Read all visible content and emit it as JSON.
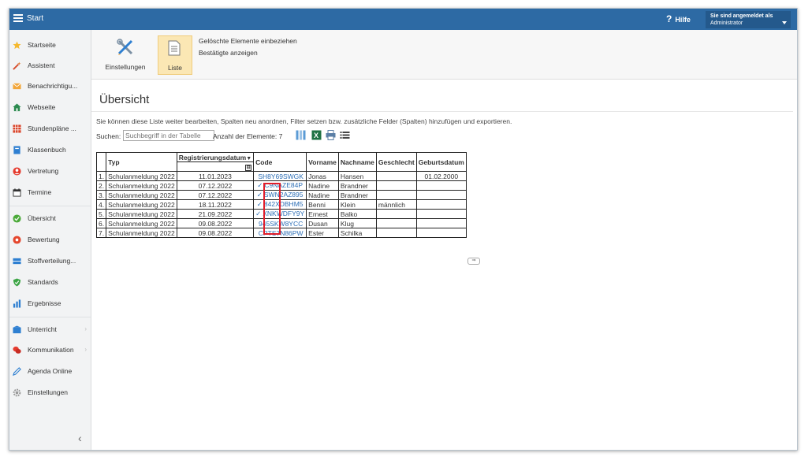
{
  "app": {
    "title": "Start",
    "help_label": "Hilfe",
    "user_line1": "Sie sind angemeldet als",
    "user_line2": "Administrator"
  },
  "sidebar": {
    "items": [
      {
        "label": "Startseite",
        "icon": "star-icon"
      },
      {
        "label": "Assistent",
        "icon": "magic-wand-icon"
      },
      {
        "label": "Benachrichtigu...",
        "icon": "envelope-icon"
      },
      {
        "label": "Webseite",
        "icon": "house-icon"
      },
      {
        "label": "Stundenpläne ...",
        "icon": "timetable-icon"
      },
      {
        "label": "Klassenbuch",
        "icon": "book-icon"
      },
      {
        "label": "Vertretung",
        "icon": "person-icon"
      },
      {
        "label": "Termine",
        "icon": "calendar-icon"
      },
      {
        "label": "Übersicht",
        "icon": "check-circle-icon"
      },
      {
        "label": "Bewertung",
        "icon": "rating-icon"
      },
      {
        "label": "Stoffverteilung...",
        "icon": "distribution-icon"
      },
      {
        "label": "Standards",
        "icon": "shield-icon"
      },
      {
        "label": "Ergebnisse",
        "icon": "bar-chart-icon"
      },
      {
        "label": "Unterricht",
        "icon": "classroom-icon"
      },
      {
        "label": "Kommunikation",
        "icon": "chat-icon"
      },
      {
        "label": "Agenda Online",
        "icon": "pen-icon"
      },
      {
        "label": "Einstellungen",
        "icon": "gear-icon"
      }
    ],
    "arrow": "›",
    "collapse": "‹"
  },
  "ribbon": {
    "settings_label": "Einstellungen",
    "list_label": "Liste",
    "link1": "Gelöschte Elemente einbeziehen",
    "link2": "Bestätigte anzeigen"
  },
  "main": {
    "title": "Übersicht",
    "description": "Sie können diese Liste weiter bearbeiten, Spalten neu anordnen, Filter setzen bzw. zusätzliche Felder (Spalten) hinzufügen und exportieren.",
    "search_label": "Suchen:",
    "search_placeholder": "Suchbegriff in der Tabelle",
    "count_label": "Anzahl der Elemente: 7"
  },
  "table": {
    "columns": [
      "Typ",
      "Registrierungsdatum",
      "Code",
      "Vorname",
      "Nachname",
      "Geschlecht",
      "Geburtsdatum"
    ],
    "sort_indicator": "▼",
    "filter_indicator": "⊟",
    "rows": [
      {
        "num": "1.",
        "typ": "Schulanmeldung 2022",
        "datum": "11.01.2023",
        "check": "",
        "code": "SH8Y69SWGK",
        "vorname": "Jonas",
        "nachname": "Hansen",
        "geschlecht": "",
        "geburtsdatum": "01.02.2000"
      },
      {
        "num": "2.",
        "typ": "Schulanmeldung 2022",
        "datum": "07.12.2022",
        "check": "✓",
        "code": "C9NAZE84P",
        "vorname": "Nadine",
        "nachname": "Brandner",
        "geschlecht": "",
        "geburtsdatum": ""
      },
      {
        "num": "3.",
        "typ": "Schulanmeldung 2022",
        "datum": "07.12.2022",
        "check": "✓",
        "code": "SWN2AZ895",
        "vorname": "Nadine",
        "nachname": "Brandner",
        "geschlecht": "",
        "geburtsdatum": ""
      },
      {
        "num": "4.",
        "typ": "Schulanmeldung 2022",
        "datum": "18.11.2022",
        "check": "✓",
        "code": "842XDBHM5",
        "vorname": "Benni",
        "nachname": "Klein",
        "geschlecht": "männlich",
        "geburtsdatum": ""
      },
      {
        "num": "5.",
        "typ": "Schulanmeldung 2022",
        "datum": "21.09.2022",
        "check": "✓",
        "code": "XNKWDFY9Y",
        "vorname": "Ernest",
        "nachname": "Balko",
        "geschlecht": "",
        "geburtsdatum": ""
      },
      {
        "num": "6.",
        "typ": "Schulanmeldung 2022",
        "datum": "09.08.2022",
        "check": "",
        "code": "945SKW8YCC",
        "vorname": "Dusan",
        "nachname": "Klug",
        "geschlecht": "",
        "geburtsdatum": ""
      },
      {
        "num": "7.",
        "typ": "Schulanmeldung 2022",
        "datum": "09.08.2022",
        "check": "",
        "code": "CPTS7N86PW",
        "vorname": "Ester",
        "nachname": "Schilka",
        "geschlecht": "",
        "geburtsdatum": ""
      }
    ],
    "scroll_glyph": "⇒"
  },
  "colors": {
    "header": "#2d6aa4",
    "link": "#2e6fb6",
    "highlight": "#e11d2a",
    "active": "#fbe7b4"
  }
}
